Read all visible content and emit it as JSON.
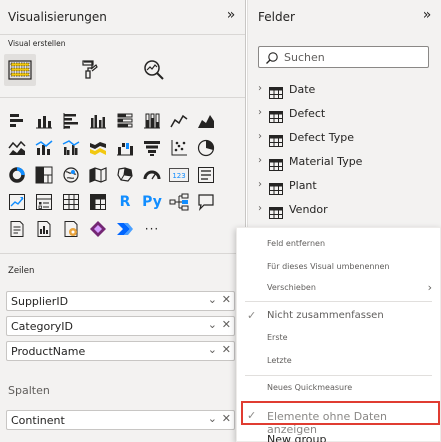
{
  "visualizations": {
    "title": "Visualisierungen",
    "build_label": "Visual erstellen",
    "rows_label": "Zeilen",
    "columns_label": "Spalten",
    "row_fields": [
      {
        "name": "SupplierID"
      },
      {
        "name": "CategoryID"
      },
      {
        "name": "ProductName"
      }
    ],
    "column_fields": [
      {
        "name": "Continent"
      }
    ],
    "icons": {
      "r_label": "R",
      "py_label": "Py",
      "card_label": "123",
      "more_label": "···",
      "accent": "#118dff",
      "dark": "#252423"
    }
  },
  "fields": {
    "title": "Felder",
    "search_placeholder": "Suchen",
    "tables": [
      {
        "name": "Date"
      },
      {
        "name": "Defect"
      },
      {
        "name": "Defect Type"
      },
      {
        "name": "Material Type"
      },
      {
        "name": "Plant"
      },
      {
        "name": "Vendor"
      }
    ]
  },
  "context_menu": {
    "items": [
      {
        "label": "Feld entfernen"
      },
      {
        "label": "Für dieses Visual umbenennen"
      },
      {
        "label": "Verschieben"
      },
      {
        "label": "Nicht zusammenfassen",
        "checked": true
      },
      {
        "label": "Erste"
      },
      {
        "label": "Letzte"
      },
      {
        "label": "Neues Quickmeasure"
      },
      {
        "label": "Elemente ohne Daten anzeigen",
        "checked": true,
        "highlighted": true
      },
      {
        "label": "New group"
      }
    ],
    "highlight_color": "#e03c31"
  },
  "glyphs": {
    "collapse": "»",
    "chevron_right": "›",
    "chevron_down": "⌄",
    "close": "✕",
    "check": "✓",
    "submenu": "›"
  }
}
